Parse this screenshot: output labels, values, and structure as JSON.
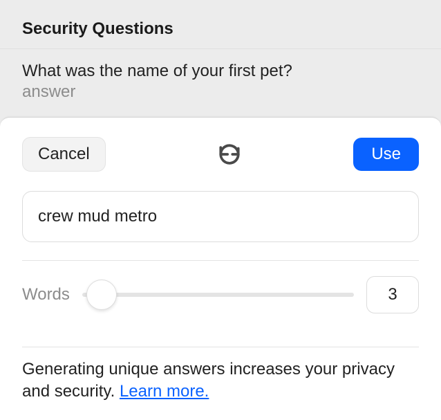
{
  "header": {
    "title": "Security Questions"
  },
  "question": {
    "prompt": "What was the name of your first pet?",
    "answer_placeholder": "answer"
  },
  "panel": {
    "cancel_label": "Cancel",
    "use_label": "Use",
    "generated_value": "crew mud metro"
  },
  "slider": {
    "label": "Words",
    "value": "3"
  },
  "footer": {
    "text_prefix": "Generating unique answers increases your privacy and security. ",
    "learn_more": "Learn more."
  }
}
